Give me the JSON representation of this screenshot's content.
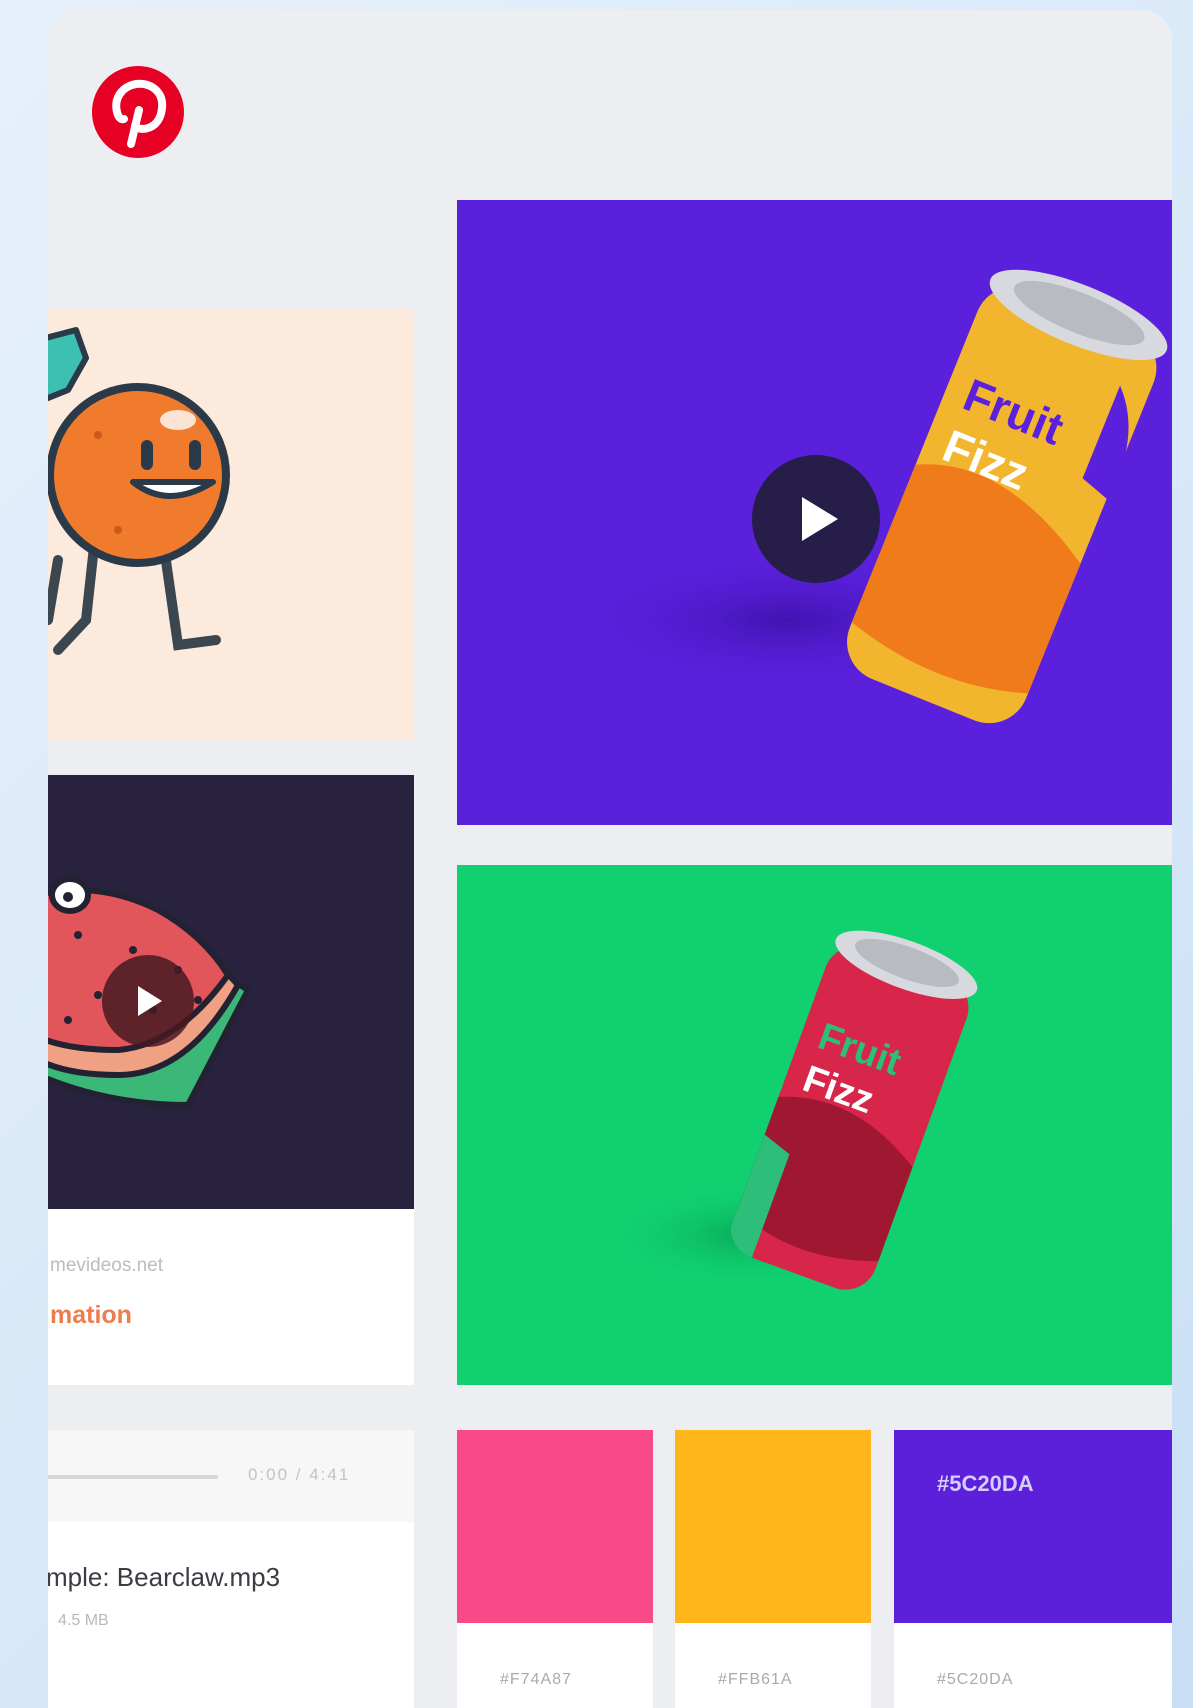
{
  "brand": {
    "logo_icon": "pinterest-logo-icon",
    "color": "#e60023"
  },
  "pins": {
    "orange_character": {
      "icon": "orange-character-illustration"
    },
    "watermelon_video": {
      "play_icon": "play-icon",
      "source": "mevideos.net",
      "title": "mation"
    },
    "audio_file": {
      "time": "0:00 / 4:41",
      "filename": "mple: Bearclaw.mp3",
      "size": "4.5 MB"
    },
    "fruit_fizz_purple": {
      "can_brand": "Fruit",
      "can_flavor": "Fizz",
      "background": "#5C20DA",
      "play_icon": "play-icon"
    },
    "fruit_fizz_green": {
      "can_brand": "Fruit",
      "can_flavor": "Fizz",
      "background": "#10D070"
    }
  },
  "palette": [
    {
      "hex": "#F74A87",
      "chip_label": ""
    },
    {
      "hex": "#FFB61A",
      "chip_label": ""
    },
    {
      "hex": "#5C20DA",
      "chip_label": "#5C20DA"
    }
  ]
}
